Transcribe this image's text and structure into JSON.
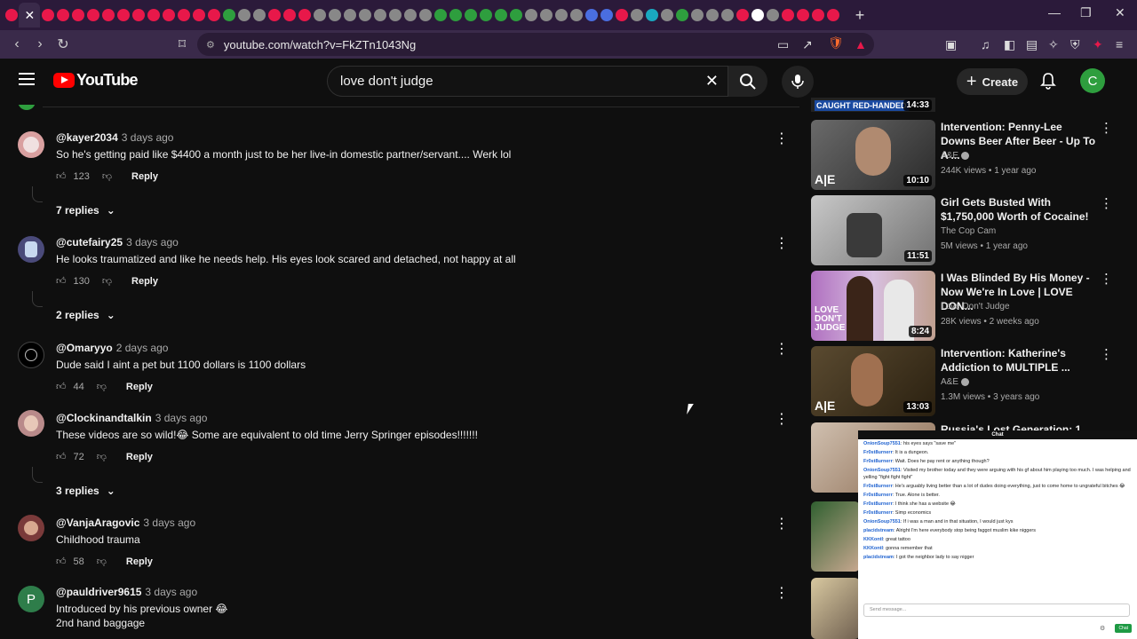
{
  "browser": {
    "url": "youtube.com/watch?v=FkZTn1043Ng",
    "close_tab": "✕",
    "new_tab": "+"
  },
  "header": {
    "logo_text": "YouTube",
    "search_value": "love don't judge",
    "create_label": "Create",
    "avatar_letter": "C"
  },
  "comments": [
    {
      "user": "@kayer2034",
      "time": "3 days ago",
      "text": "So he's getting paid like $4400 a month just to be her live-in domestic partner/servant....  Werk lol",
      "likes": "123",
      "replies": "7 replies"
    },
    {
      "user": "@cutefairy25",
      "time": "3 days ago",
      "text": "He looks traumatized and like he needs help. His eyes look scared and detached, not happy at all",
      "likes": "130",
      "replies": "2 replies"
    },
    {
      "user": "@Omaryyo",
      "time": "2 days ago",
      "text": "Dude said I aint a pet but 1100 dollars is 1100 dollars",
      "likes": "44",
      "replies": ""
    },
    {
      "user": "@Clockinandtalkin",
      "time": "3 days ago",
      "text": "These videos are so wild!😂 Some are equivalent to old time Jerry Springer episodes!!!!!!!",
      "likes": "72",
      "replies": "3 replies"
    },
    {
      "user": "@VanjaAragovic",
      "time": "3 days ago",
      "text": "Childhood trauma",
      "likes": "58",
      "replies": ""
    },
    {
      "user": "@pauldriver9615",
      "time": "3 days ago",
      "text": "Introduced by his previous owner 😂",
      "text2": "2nd hand baggage",
      "likes": "",
      "replies": "",
      "avatar_letter": "P"
    }
  ],
  "reply_label": "Reply",
  "sidebar": {
    "top_badge": "CAUGHT RED-HANDED",
    "top_duration": "14:33",
    "videos": [
      {
        "title": "Intervention: Penny-Lee Downs Beer After Beer - Up To A ...",
        "channel": "A&E",
        "verified": true,
        "meta": "244K views • 1 year ago",
        "duration": "10:10"
      },
      {
        "title": "Girl Gets Busted With $1,750,000 Worth of Cocaine!",
        "channel": "The Cop Cam",
        "verified": false,
        "meta": "5M views • 1 year ago",
        "duration": "11:51"
      },
      {
        "title": "I Was Blinded By His Money - Now We're In Love | LOVE DON...",
        "channel": "Love Don't Judge",
        "verified": false,
        "meta": "28K views • 2 weeks ago",
        "duration": "8:24"
      },
      {
        "title": "Intervention: Katherine's Addiction to MULTIPLE ...",
        "channel": "A&E",
        "verified": true,
        "meta": "1.3M views • 3 years ago",
        "duration": "13:03"
      },
      {
        "title": "Russia's Lost Generation: 1",
        "channel": "",
        "verified": false,
        "meta": "",
        "duration": ""
      }
    ]
  },
  "chat": {
    "title": "Chat",
    "lines": [
      {
        "user": "OnionSoup7551",
        "text": "his eyes says \"save me\""
      },
      {
        "user": "Fr0st8urnerr",
        "text": "It is a dungeon."
      },
      {
        "user": "Fr0st8urnerr",
        "text": "Wait. Does he pay rent or anything though?"
      },
      {
        "user": "OnionSoup7551",
        "text": "Visited my brother today and they were arguing with his gf about him playing too much. I was helping and yelling \"fight fight fight\""
      },
      {
        "user": "Fr0st8urnerr",
        "text": "He's arguably living better than a lot of dudes doing everything, just to come home to ungrateful bitches 😂"
      },
      {
        "user": "Fr0st8urnerr",
        "text": "True. Alone is better."
      },
      {
        "user": "Fr0st8urnerr",
        "text": "I think she has a website 😂"
      },
      {
        "user": "Fr0st8urnerr",
        "text": "Simp economics"
      },
      {
        "user": "OnionSoup7551",
        "text": "If i was a man and in that situation, I would just kys"
      },
      {
        "user": "placidstream",
        "text": "Alright I'm here everybody stop being faggot muslim kike niggers"
      },
      {
        "user": "KKKontI",
        "text": "great tattoo"
      },
      {
        "user": "KKKontI",
        "text": "gonna remember that"
      },
      {
        "user": "placidstream",
        "text": "I got the neighbor lady to say nigger"
      }
    ],
    "input_placeholder": "Send message...",
    "send_label": "Chat"
  },
  "colors": {
    "tab_icon_colors": [
      "#e8184a",
      "#e8184a",
      "#e8184a",
      "#e8184a",
      "#e8184a",
      "#e8184a",
      "#e8184a",
      "#e8184a",
      "#e8184a",
      "#e8184a",
      "#e8184a",
      "#e8184a",
      "#e8184a",
      "#2e9e3e",
      "#888888",
      "#888888",
      "#e8184a",
      "#e8184a",
      "#e8184a",
      "#888888",
      "#888888",
      "#888888",
      "#888888",
      "#888888",
      "#888888",
      "#888888",
      "#888888",
      "#2e9e3e",
      "#2e9e3e",
      "#2e9e3e",
      "#2e9e3e",
      "#2e9e3e",
      "#2e9e3e",
      "#888888",
      "#888888",
      "#888888",
      "#888888",
      "#4a6ee0",
      "#4a6ee0",
      "#e8184a",
      "#888888",
      "#1aa8c0",
      "#888888",
      "#2e9e3e",
      "#888888",
      "#888888",
      "#888888",
      "#e8184a",
      "#ffffff",
      "#888888",
      "#e8184a",
      "#e8184a",
      "#e8184a",
      "#e8184a"
    ]
  }
}
